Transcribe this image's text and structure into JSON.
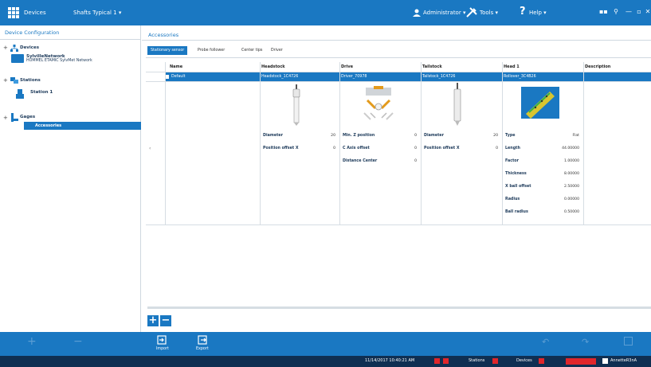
{
  "titlebar": {
    "app_name": "Devices",
    "project": "Shafts Typical 1 ▾",
    "user_label": "Administrator ▾",
    "tools_label": "Tools ▾",
    "help_label": "Help ▾"
  },
  "left_panel": {
    "title": "Device Configuration",
    "tree": {
      "devices_label": "Devices",
      "network_label": "SylvilleNetwork",
      "network_sub": "HOMMEL ETAMIC SylvMet Network",
      "stations_label": "Stations",
      "station_label": "Station 1",
      "gages_label": "Gages",
      "accessories_label": "Accessories"
    }
  },
  "right_panel": {
    "title": "Accessories",
    "tabs": [
      "Stationary sensor",
      "Probe follower",
      "Center tips",
      "Driver"
    ],
    "columns": [
      "Name",
      "Headstock",
      "Drive",
      "Tailstock",
      "Head 1",
      "Description"
    ],
    "selected_row": {
      "name": "Default",
      "headstock": "Headstock_1C4726",
      "drive": "Driver_70978",
      "tailstock": "Tailstock_1C4726",
      "head1": "Rollover_3C4B26"
    },
    "headstock_props": [
      {
        "label": "Diameter",
        "unit": "20",
        "value": ""
      },
      {
        "label": "Position offset X",
        "unit": "0",
        "value": ""
      }
    ],
    "drive_props": [
      {
        "label": "Min. Z position",
        "unit": "0",
        "value": ""
      },
      {
        "label": "C Axis offset",
        "unit": "0",
        "value": ""
      },
      {
        "label": "Distance Center",
        "unit": "0",
        "value": ""
      }
    ],
    "tailstock_props": [
      {
        "label": "Diameter",
        "unit": "20",
        "value": ""
      },
      {
        "label": "Position offset X",
        "unit": "0",
        "value": ""
      }
    ],
    "head_props": [
      {
        "label": "Type",
        "value": "Flat"
      },
      {
        "label": "Length",
        "value": "44.00000"
      },
      {
        "label": "Factor",
        "value": "1.00000"
      },
      {
        "label": "Thickness",
        "value": "8.00000"
      },
      {
        "label": "X ball offset",
        "value": "2.50000"
      },
      {
        "label": "Radius",
        "value": "0.00000"
      },
      {
        "label": "Ball radius",
        "value": "0.50000"
      }
    ]
  },
  "bottombar": {
    "import_label": "Import",
    "export_label": "Export"
  },
  "statusbar": {
    "datetime": "11/14/2017 10:40:21 AM",
    "stations_label": "Stations",
    "devices_label": "Devices",
    "user": "AnnetteR3nA"
  }
}
